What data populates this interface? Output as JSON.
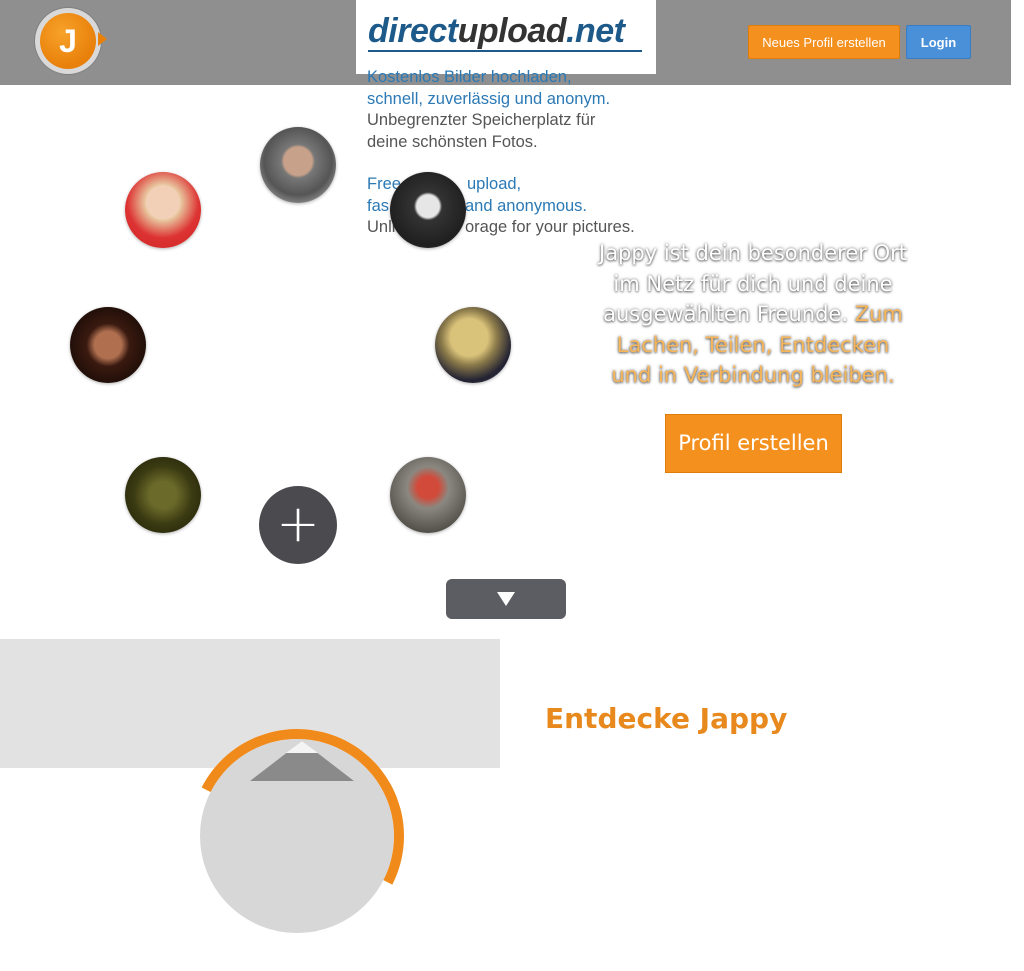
{
  "header": {
    "logo_letter": "J",
    "new_profile_label": "Neues Profil erstellen",
    "login_label": "Login"
  },
  "overlay": {
    "brand_part1": "direct",
    "brand_part2": "upload",
    "brand_part3": ".net",
    "lines": [
      {
        "text": "Kostenlos Bilder hochladen,",
        "color": "#2b79b5"
      },
      {
        "text": "schnell, zuverlässig und anonym.",
        "color": "#2b79b5"
      },
      {
        "text": "Unbegrenzter Speicherplatz für",
        "color": "#555555"
      },
      {
        "text": "deine schönsten Fotos.",
        "color": "#555555"
      },
      {
        "text": "Free",
        "color": "#2b79b5"
      },
      {
        "text": "upload,",
        "color": "#2b79b5"
      },
      {
        "text": "fas",
        "color": "#2b79b5"
      },
      {
        "text": "and anonymous.",
        "color": "#2b79b5"
      },
      {
        "text": "Unli",
        "color": "#555555"
      },
      {
        "text": "orage for your pictures.",
        "color": "#555555"
      }
    ]
  },
  "hero": {
    "tagline_white": "Jappy ist dein besonderer Ort im Netz für dich und deine ausgewählten Freunde.",
    "tagline_accent": "Zum Lachen, Teilen, Entdecken und in Verbindung bleiben.",
    "profile_button": "Profil erstellen",
    "plus_symbol": "+"
  },
  "lower": {
    "discover_title": "Entdecke Jappy"
  },
  "icons": {
    "logo": "jappy-logo-icon",
    "plus": "plus-icon",
    "scroll": "chevron-down-icon"
  },
  "colors": {
    "accent": "#f4901e",
    "login": "#4a90d9",
    "header_bg": "#8f8f8f"
  }
}
